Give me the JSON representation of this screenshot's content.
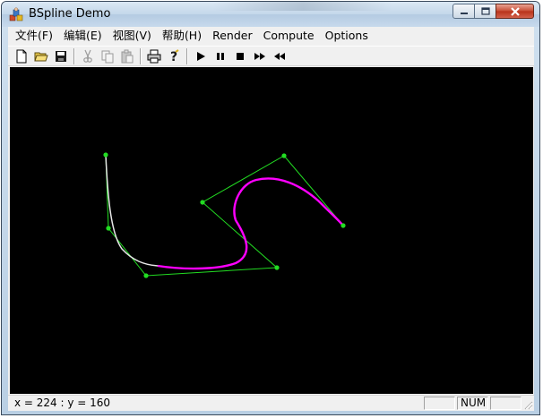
{
  "window": {
    "title": "BSpline Demo",
    "app_icon": "app-icon"
  },
  "menu": [
    {
      "label": "文件(F)"
    },
    {
      "label": "编辑(E)"
    },
    {
      "label": "视图(V)"
    },
    {
      "label": "帮助(H)"
    },
    {
      "label": "Render"
    },
    {
      "label": "Compute"
    },
    {
      "label": "Options"
    }
  ],
  "toolbar": {
    "buttons": [
      "new-file-icon",
      "open-folder-icon",
      "save-icon",
      "cut-icon",
      "copy-icon",
      "paste-icon",
      "print-icon",
      "help-icon",
      "play-icon",
      "pause-icon",
      "stop-icon",
      "fast-forward-icon",
      "rewind-icon"
    ]
  },
  "canvas": {
    "background": "#000000",
    "control_polygon_color": "#22dd22",
    "curve_color_primary": "#ff00ff",
    "curve_color_secondary": "#e8e8e8"
  },
  "status": {
    "coords": "x = 224 : y = 160",
    "num_indicator": "NUM"
  }
}
